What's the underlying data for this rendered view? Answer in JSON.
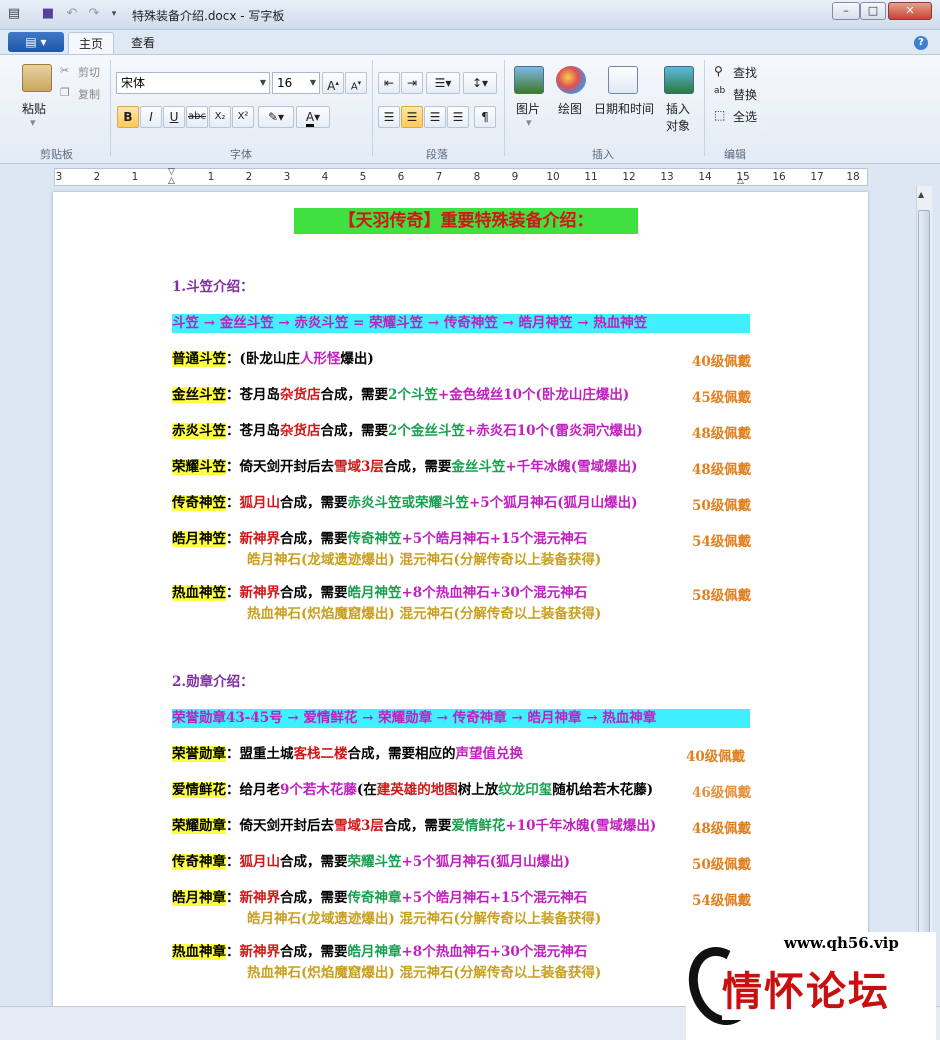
{
  "window": {
    "title": "特殊装备介绍.docx - 写字板"
  },
  "tabs": [
    "主页",
    "查看"
  ],
  "clipboard": {
    "paste": "粘贴",
    "cut": "剪切",
    "copy": "复制",
    "group": "剪贴板"
  },
  "font": {
    "name": "宋体",
    "size": "16",
    "group": "字体"
  },
  "paragraph": {
    "group": "段落"
  },
  "insert": {
    "picture": "图片",
    "paint": "绘图",
    "datetime": "日期和时间",
    "object1": "插入",
    "object2": "对象",
    "group": "插入"
  },
  "edit": {
    "find": "查找",
    "replace": "替换",
    "selectall": "全选",
    "group": "编辑"
  },
  "ruler": [
    "3",
    "2",
    "1",
    "1",
    "2",
    "3",
    "4",
    "5",
    "6",
    "7",
    "8",
    "9",
    "10",
    "11",
    "12",
    "13",
    "14",
    "15",
    "16",
    "17",
    "18"
  ],
  "doc": {
    "title": "【天羽传奇】重要特殊装备介绍：",
    "s1": "1.斗笠介绍：",
    "chain1": "斗笠 → 金丝斗笠 → 赤炎斗笠 = 荣耀斗笠 → 传奇神笠 → 皓月神笠 → 热血神笠",
    "hat": [
      {
        "name": "普通斗笠",
        "p1": "：(卧龙山庄",
        "p2": "人形怪",
        "p3": "爆出)",
        "lvl": "40级佩戴"
      },
      {
        "name": "金丝斗笠",
        "p1": "：苍月岛",
        "p2": "杂货店",
        "p3": "合成，需要",
        "p4": "2个斗笠",
        "p5": "+金色绒丝10个(卧龙山庄爆出)",
        "lvl": "45级佩戴"
      },
      {
        "name": "赤炎斗笠",
        "p1": "：苍月岛",
        "p2": "杂货店",
        "p3": "合成，需要",
        "p4": "2个金丝斗笠",
        "p5": "+赤炎石10个(雷炎洞穴爆出)",
        "lvl": "48级佩戴"
      },
      {
        "name": "荣耀斗笠",
        "p1": "：倚天剑开封后去",
        "p2": "雪域3层",
        "p3": "合成，需要",
        "p4": "金丝斗笠",
        "p5": "+千年冰魄(雪域爆出)",
        "lvl": "48级佩戴"
      },
      {
        "name": "传奇神笠",
        "p1": "：",
        "p2": "狐月山",
        "p3": "合成，需要",
        "p4": "赤炎斗笠或荣耀斗笠",
        "p5": "+5个狐月神石(狐月山爆出)",
        "lvl": "50级佩戴"
      },
      {
        "name": "皓月神笠",
        "p1": "：",
        "p2": "新神界",
        "p3": "合成，需要",
        "p4": "传奇神笠",
        "p5": "+5个皓月神石+15个混元神石",
        "lvl": "54级佩戴",
        "sub": "皓月神石(龙域遗迹爆出)   混元神石(分解传奇以上装备获得)"
      },
      {
        "name": "热血神笠",
        "p1": "：",
        "p2": "新神界",
        "p3": "合成，需要",
        "p4": "皓月神笠",
        "p5": "+8个热血神石+30个混元神石",
        "lvl": "58级佩戴",
        "sub": "热血神石(炽焰魔窟爆出)   混元神石(分解传奇以上装备获得)"
      }
    ],
    "s2": "2.勋章介绍：",
    "chain2": "荣誉勋章43-45号 → 爱情鲜花 → 荣耀勋章 → 传奇神章 → 皓月神章 → 热血神章",
    "medal": [
      {
        "name": "荣誉勋章",
        "p1": "：盟重土城",
        "p2": "客栈二楼",
        "p3": "合成，需要相应的",
        "p4": "声望值兑换",
        "lvl": "40级佩戴"
      },
      {
        "name": "爱情鲜花",
        "p1": "：给月老",
        "p2": "9个若木花藤",
        "p3": "(在",
        "p4": "建英雄的地图",
        "p5": "树上放",
        "p6": "纹龙印玺",
        "p7": "随机给若木花藤)",
        "lvl": "46级佩戴"
      },
      {
        "name": "荣耀勋章",
        "p1": "：倚天剑开封后去",
        "p2": "雪域3层",
        "p3": "合成，需要",
        "p4": "爱情鲜花",
        "p5": "+10千年冰魄(雪域爆出)",
        "lvl": "48级佩戴"
      },
      {
        "name": "传奇神章",
        "p1": "：",
        "p2": "狐月山",
        "p3": "合成，需要",
        "p4": "荣耀斗笠",
        "p5": "+5个狐月神石(狐月山爆出)",
        "lvl": "50级佩戴"
      },
      {
        "name": "皓月神章",
        "p1": "：",
        "p2": "新神界",
        "p3": "合成，需要",
        "p4": "传奇神章",
        "p5": "+5个皓月神石+15个混元神石",
        "lvl": "54级佩戴",
        "sub": "皓月神石(龙域遗迹爆出)   混元神石(分解传奇以上装备获得)"
      },
      {
        "name": "热血神章",
        "p1": "：",
        "p2": "新神界",
        "p3": "合成，需要",
        "p4": "皓月神章",
        "p5": "+8个热血神石+30个混元神石",
        "lvl": "",
        "sub": "热血神石(炽焰魔窟爆出)   混元神石(分解传奇以上装备获得)"
      }
    ]
  },
  "watermark": {
    "url": "www.qh56.vip",
    "text": "情怀论坛"
  }
}
